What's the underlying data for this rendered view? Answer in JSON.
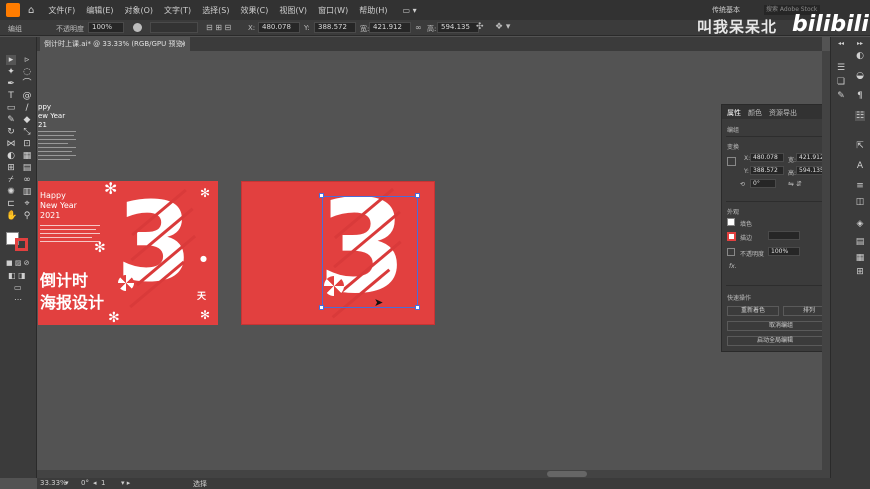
{
  "menubar": {
    "items": [
      "文件(F)",
      "编辑(E)",
      "对象(O)",
      "文字(T)",
      "选择(S)",
      "效果(C)",
      "视图(V)",
      "窗口(W)",
      "帮助(H)"
    ],
    "workspace": "传统基本",
    "search_placeholder": "搜索 Adobe Stock"
  },
  "control": {
    "group_label": "编组",
    "opacity_label": "不透明度",
    "opacity_value": "100%",
    "x_label": "X:",
    "x_value": "480.078",
    "y_label": "Y:",
    "y_value": "388.572",
    "w_label": "宽:",
    "w_value": "421.912",
    "h_label": "高:",
    "h_value": "594.135"
  },
  "document": {
    "tab_title": "倒计时上课.ai* @ 33.33% (RGB/GPU 预览)"
  },
  "artboard1": {
    "side_text": [
      "ppy",
      "ew Year",
      "21"
    ],
    "greeting": [
      "Happy",
      "New Year",
      "2021"
    ],
    "title_line1": "倒计时",
    "title_line2": "海报设计",
    "day_char": "天",
    "number": "3"
  },
  "artboard2": {
    "number": "3"
  },
  "properties": {
    "tabs": [
      "属性",
      "颜色",
      "资源导出"
    ],
    "group_title": "编组",
    "transform_title": "变换",
    "x_value": "480.078",
    "y_value": "388.572",
    "w_value": "421.912",
    "h_value": "594.135",
    "angle_value": "0°",
    "appearance_title": "外观",
    "fill_label": "填色",
    "stroke_label": "描边",
    "opacity_label": "不透明度",
    "opacity_value": "100%",
    "fx_label": "fx.",
    "quick_actions_title": "快速操作",
    "btn_recolor": "重新着色",
    "btn_arrange": "排列",
    "btn_ungroup": "取消编组",
    "btn_start_global": "启动全局编辑"
  },
  "status": {
    "zoom": "33.33%",
    "angle": "0°",
    "artboard_num": "1",
    "tool_name": "选择"
  },
  "watermark": {
    "text": "叫我呆呆北",
    "logo": "bilibili"
  },
  "colors": {
    "poster_red": "#e2403f",
    "app_bg": "#535353",
    "panel_bg": "#3b3b3b"
  }
}
